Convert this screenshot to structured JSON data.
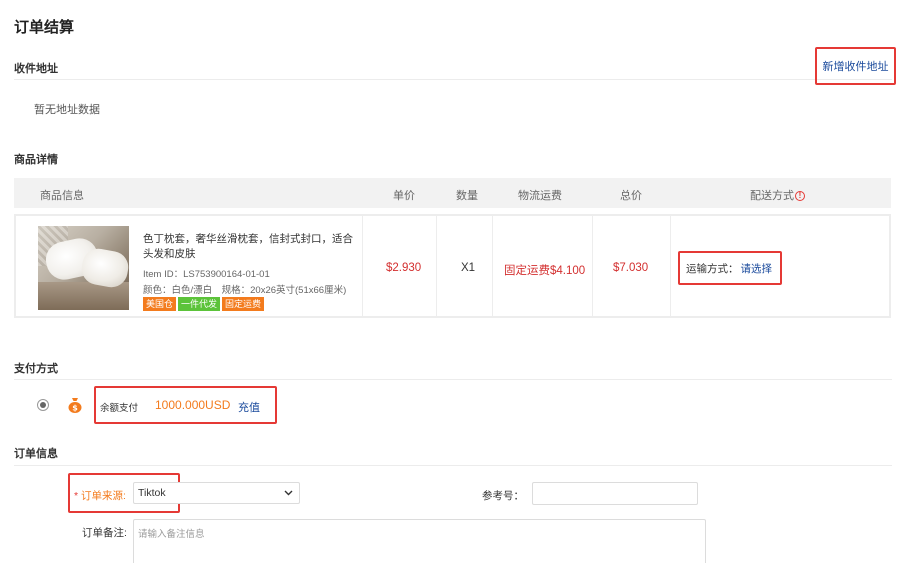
{
  "page_title": "订单结算",
  "address": {
    "section_title": "收件地址",
    "add_link": "新增收件地址",
    "empty_text": "暂无地址数据"
  },
  "goods": {
    "section_title": "商品详情",
    "headers": {
      "info": "商品信息",
      "unit_price": "单价",
      "quantity": "数量",
      "shipping_fee": "物流运费",
      "total": "总价",
      "delivery": "配送方式"
    },
    "item": {
      "name": "色丁枕套，奢华丝滑枕套，信封式封口，适合头发和皮肤",
      "item_id": "Item ID：LS753900164-01-01",
      "spec": "颜色：白色/漂白　规格：20x26英寸(51x66厘米)",
      "tags": [
        "美国仓",
        "一件代发",
        "固定运费"
      ],
      "unit_price": "$2.930",
      "quantity": "X1",
      "shipping_fee": "固定运费$4.100",
      "total": "$7.030",
      "shipping_method_label": "运输方式：",
      "shipping_method_action": "请选择"
    }
  },
  "payment": {
    "section_title": "支付方式",
    "method_label": "余额支付",
    "balance": "1000.000USD",
    "recharge": "充值"
  },
  "order_info": {
    "section_title": "订单信息",
    "source_required_mark": "*",
    "source_label": "订单来源:",
    "source_value": "Tiktok",
    "reference_label": "参考号：",
    "reference_value": "",
    "note_label": "订单备注:",
    "note_placeholder": "请输入备注信息"
  },
  "colors": {
    "link_blue": "#1a4a9c",
    "price_red": "#d32f2f",
    "accent_orange": "#f37b1d",
    "tag_green": "#5cc33a",
    "highlight_red": "#e53935"
  }
}
